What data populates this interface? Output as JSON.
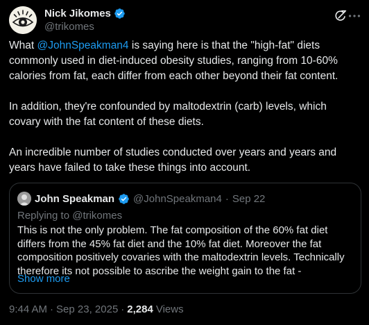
{
  "author": {
    "name": "Nick Jikomes",
    "handle": "@trikomes",
    "verified_icon": "verified-badge-icon",
    "avatar_icon": "eye-logo-icon"
  },
  "header_icons": [
    "grok-icon",
    "more-options-icon"
  ],
  "tweet": {
    "paragraphs": [
      {
        "prefix": "What ",
        "mention": "@JohnSpeakman4",
        "suffix": " is saying here is that the \"high-fat\" diets commonly used in diet-induced obesity studies, ranging from 10-60% calories from fat, each differ from each other beyond their fat content."
      },
      {
        "text": "In addition, they're confounded by maltodextrin (carb) levels, which covary with the fat content of these diets."
      },
      {
        "text": "An incredible number of studies conducted over years and years and years have failed to take these things into account."
      }
    ]
  },
  "quote": {
    "name": "John Speakman",
    "handle": "@JohnSpeakman4",
    "separator": "·",
    "date": "Sep 22",
    "replying_to": "Replying to @trikomes",
    "text": "This is not the only problem.  The fat composition of the 60% fat diet differs from the 45% fat diet and the 10% fat diet. Moreover the fat composition positively covaries with the maltodextrin levels. Technically therefore its not possible to ascribe the weight gain to the fat -",
    "show_more": "Show more"
  },
  "footer": {
    "time": "9:44 AM",
    "sep1": "·",
    "date": "Sep 23, 2025",
    "sep2": "·",
    "views_count": "2,284",
    "views_label": "Views"
  },
  "colors": {
    "background": "#000000",
    "text": "#e7e9ea",
    "muted": "#71767b",
    "link": "#1d9bf0",
    "border": "#2f3336"
  }
}
